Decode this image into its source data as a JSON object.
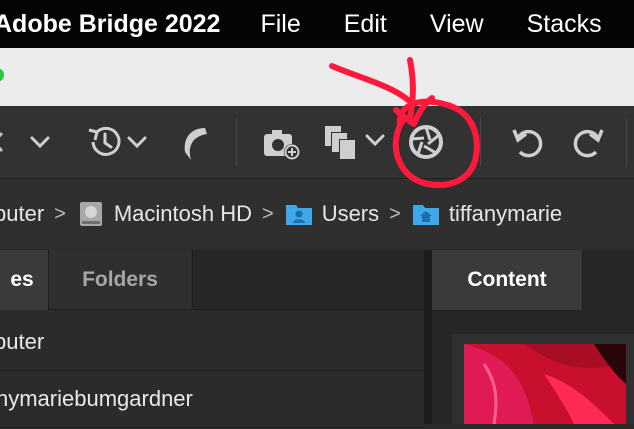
{
  "menubar": {
    "app_name": "Adobe Bridge 2022",
    "items": [
      {
        "label": "File"
      },
      {
        "label": "Edit"
      },
      {
        "label": "View"
      },
      {
        "label": "Stacks"
      }
    ]
  },
  "path": {
    "items": [
      {
        "label": "puter",
        "icon": "none"
      },
      {
        "label": "Macintosh HD",
        "icon": "hard-drive-icon"
      },
      {
        "label": "Users",
        "icon": "users-folder-icon"
      },
      {
        "label": "tiffanymarie",
        "icon": "home-folder-icon"
      }
    ],
    "separator": ">"
  },
  "left_panel": {
    "tabs": [
      {
        "label": "es"
      },
      {
        "label": "Folders"
      }
    ],
    "items": [
      {
        "label": "puter"
      },
      {
        "label": "nymariebumgardner"
      }
    ]
  },
  "right_panel": {
    "tabs": [
      {
        "label": "Content"
      }
    ]
  },
  "colors": {
    "annotation": "#ff1a3c",
    "thumbnail": "#c8102e"
  }
}
